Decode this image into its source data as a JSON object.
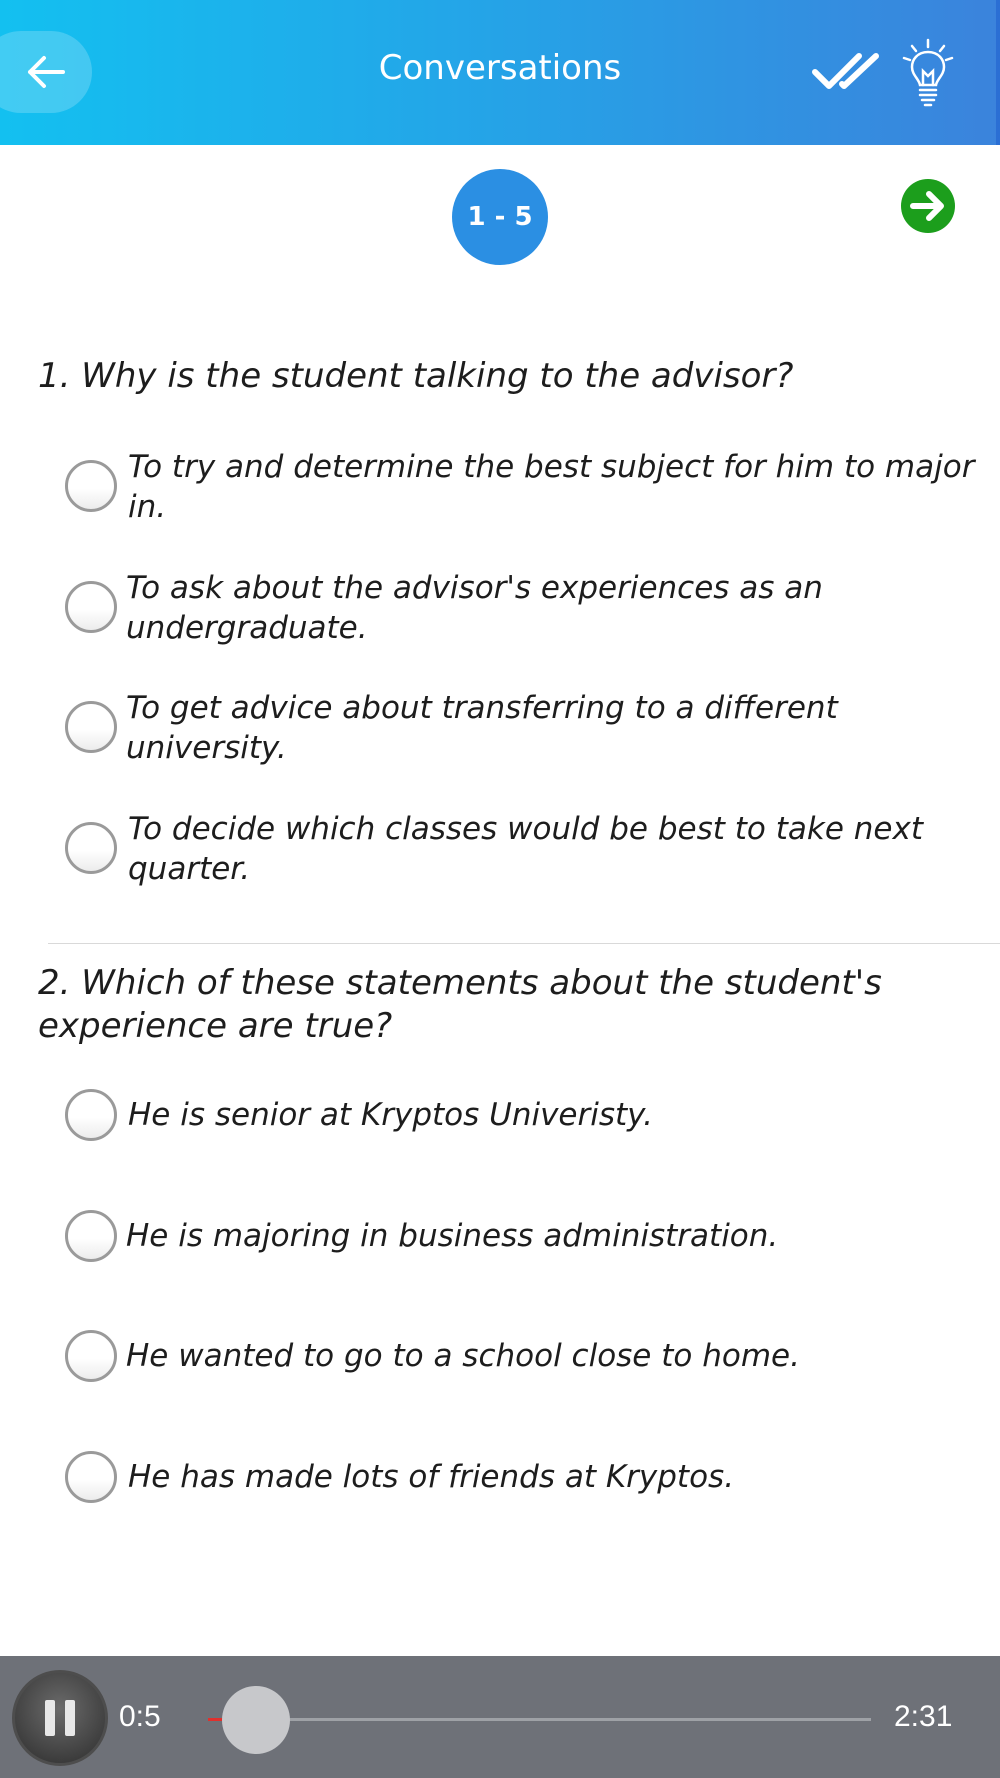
{
  "header": {
    "title": "Conversations",
    "back_icon": "arrow-left-icon",
    "check_icon": "double-check-icon",
    "hint_icon": "lightbulb-icon",
    "gradient_start": "#13c0f0",
    "gradient_end": "#3b83dc"
  },
  "pager": {
    "range": "1 - 5",
    "next_icon": "arrow-right-circle-icon",
    "badge_color": "#2b8fe3",
    "next_color": "#1c9e1c"
  },
  "questions": [
    {
      "text": "1. Why is the student talking to the advisor?",
      "options": [
        "To try and determine the best subject for him to major in.",
        "To ask about the advisor's experiences as an undergraduate.",
        "To get advice about transferring to a different university.",
        "To decide which classes would be best to take next quarter."
      ]
    },
    {
      "text": "2. Which of these statements about the student's experience are true?",
      "options": [
        "He is senior at Kryptos Univeristy.",
        "He is majoring in business administration.",
        "He wanted to go to a school close to home.",
        "He has made lots of friends at Kryptos."
      ]
    }
  ],
  "player": {
    "current_time": "0:5",
    "total_time": "2:31",
    "progress_fraction": 0.033,
    "state_icon": "pause-icon"
  }
}
